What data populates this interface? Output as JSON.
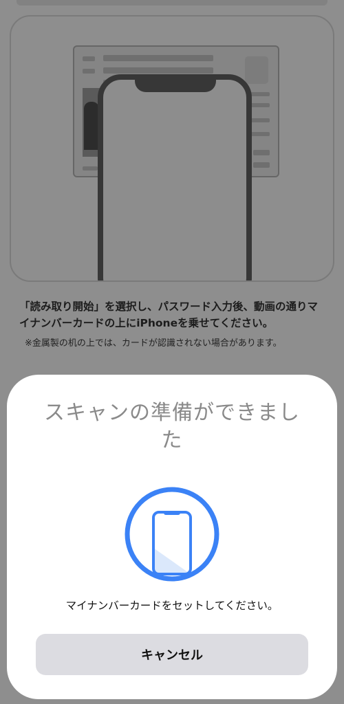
{
  "background": {
    "instruction": "「読み取り開始」を選択し、パスワード入力後、動画の通りマイナンバーカードの上にiPhoneを乗せてください。",
    "note": "※金属製の机の上では、カードが認識されない場合があります。",
    "illustration_icon": "id-card-with-phone"
  },
  "sheet": {
    "title": "スキャンの準備ができました",
    "message": "マイナンバーカードをセットしてください。",
    "cancel_label": "キャンセル",
    "icon": "phone-scan-icon",
    "accent_color": "#3b82f6"
  }
}
